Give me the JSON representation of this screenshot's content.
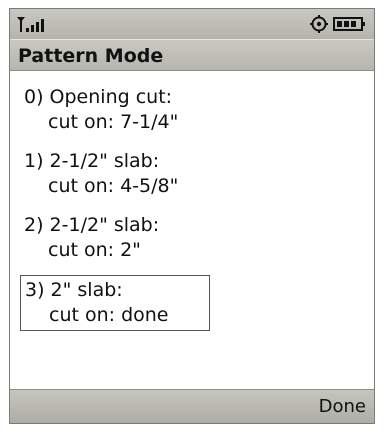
{
  "window": {
    "title": "Pattern Mode"
  },
  "status_bar": {
    "icons": [
      "antenna-signal-icon",
      "settings-icon",
      "battery-icon"
    ]
  },
  "items": [
    {
      "line1": "0) Opening cut:",
      "line2": "cut on: 7-1/4\""
    },
    {
      "line1": "1) 2-1/2\" slab:",
      "line2": "cut on: 4-5/8\""
    },
    {
      "line1": "2) 2-1/2\" slab:",
      "line2": "cut on: 2\""
    },
    {
      "line1": "3) 2\" slab:",
      "line2": "cut on: done"
    }
  ],
  "softkeys": {
    "right": "Done"
  },
  "colors": {
    "bar_bg": "#bdbdb6",
    "selection_border": "#555555"
  }
}
